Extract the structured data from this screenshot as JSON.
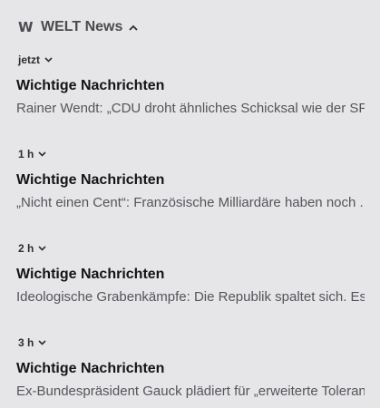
{
  "app": {
    "logo": "W",
    "name": "WELT News",
    "collapse_icon": "chevron-up-icon"
  },
  "groups": [
    {
      "time": "jetzt",
      "expand_icon": "chevron-down-icon",
      "title": "Wichtige Nachrichten",
      "text": "Rainer Wendt: „CDU droht ähnliches Schicksal wie der SP.."
    },
    {
      "time": "1 h",
      "expand_icon": "chevron-down-icon",
      "title": "Wichtige Nachrichten",
      "text": "„Nicht einen Cent“: Französische Milliardäre haben noch .."
    },
    {
      "time": "2 h",
      "expand_icon": "chevron-down-icon",
      "title": "Wichtige Nachrichten",
      "text": "Ideologische Grabenkämpfe: Die Republik spaltet sich. Es.."
    },
    {
      "time": "3 h",
      "expand_icon": "chevron-down-icon",
      "title": "Wichtige Nachrichten",
      "text": "Ex-Bundespräsident Gauck plädiert für „erweiterte Toleran.."
    }
  ]
}
